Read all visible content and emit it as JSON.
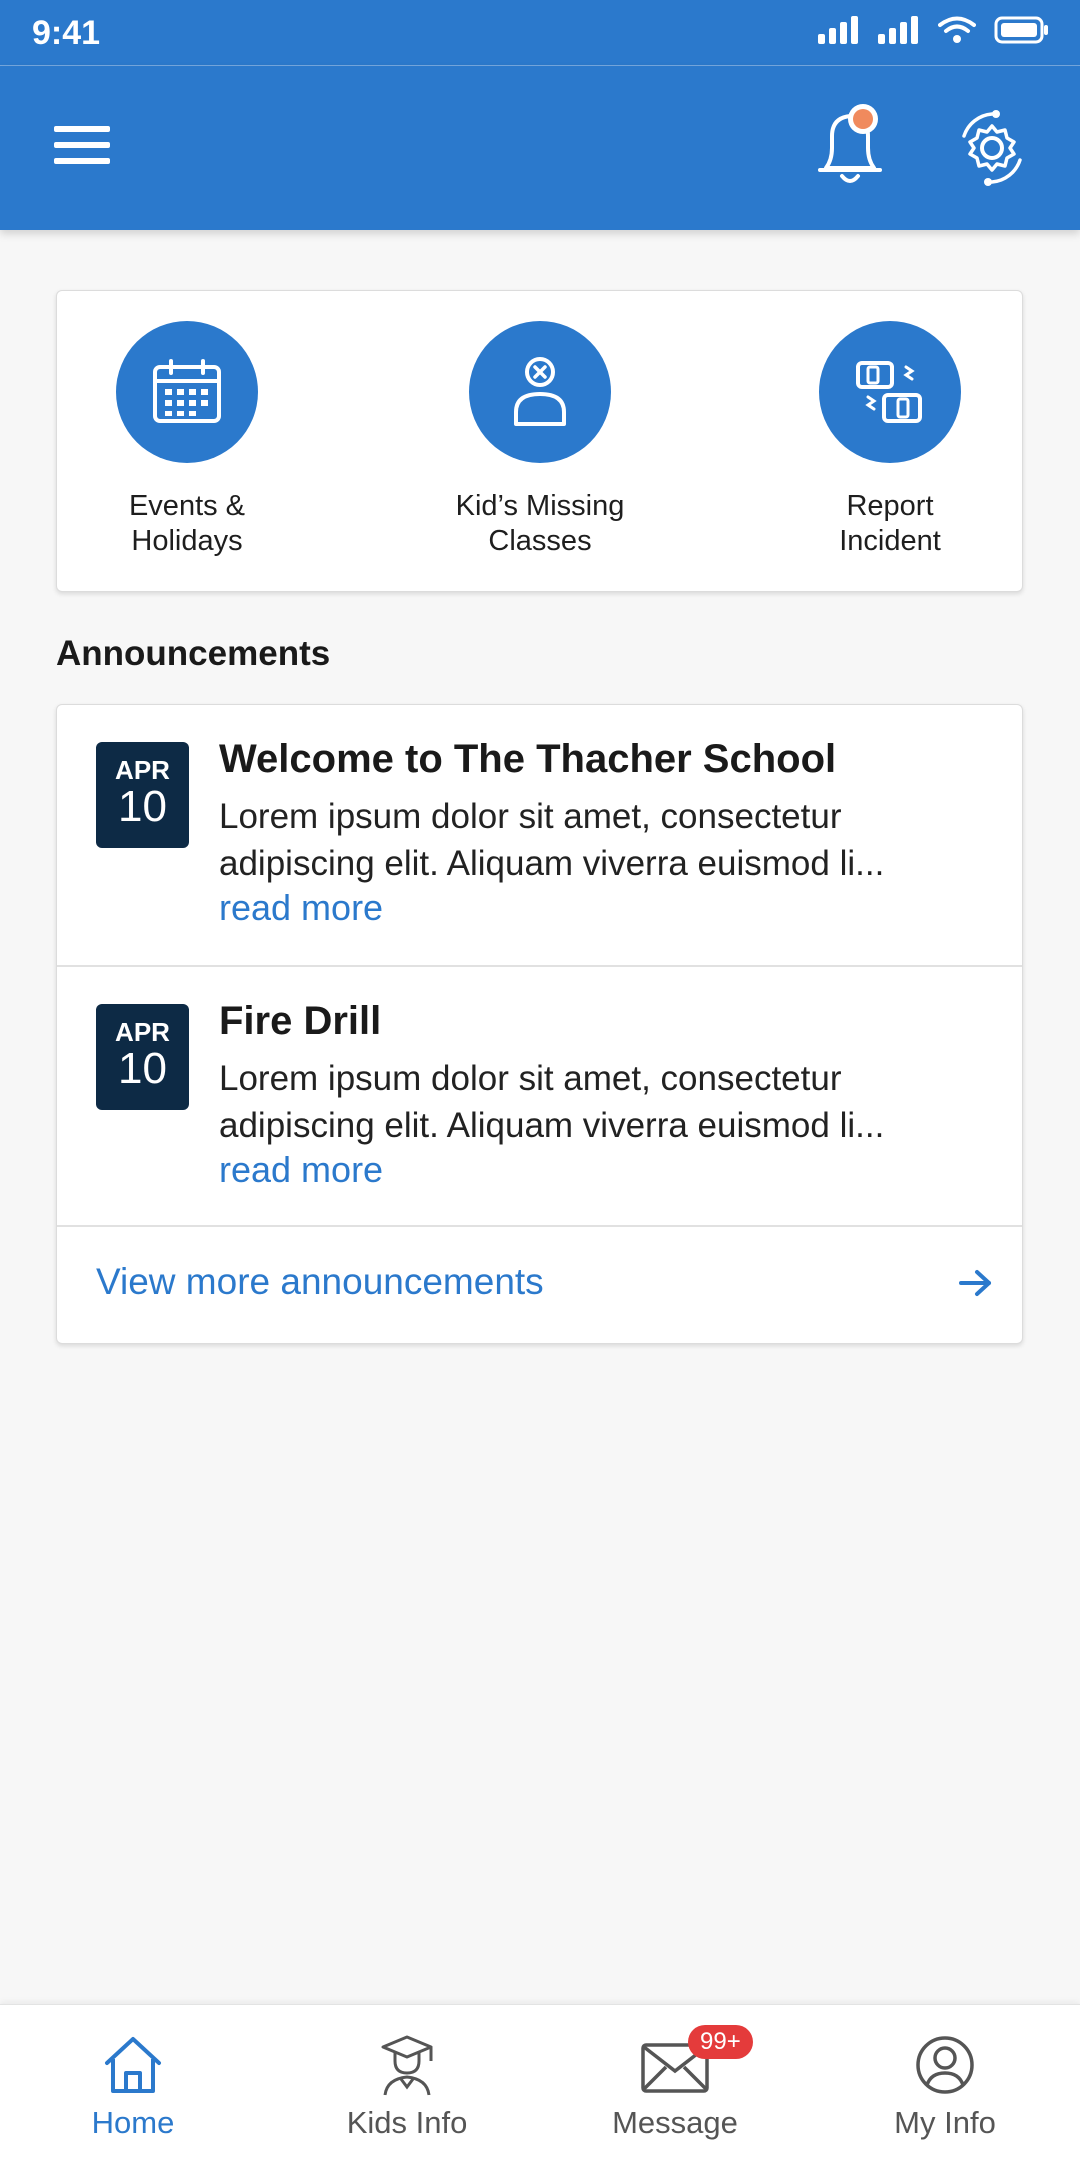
{
  "status_bar": {
    "time": "9:41"
  },
  "colors": {
    "primary": "#2b79cc",
    "date_box": "#0d2a45",
    "badge": "#e43b3b",
    "notification_dot": "#f08a5d"
  },
  "header": {
    "icons": [
      "menu-icon",
      "bell-icon",
      "settings-icon"
    ]
  },
  "quick_actions": [
    {
      "label": "Events &\nHolidays",
      "icon": "calendar-icon"
    },
    {
      "label": "Kid’s Missing\nClasses",
      "icon": "person-missing-icon"
    },
    {
      "label": "Report\nIncident",
      "icon": "incident-icon"
    }
  ],
  "announcements": {
    "title": "Announcements",
    "items": [
      {
        "month": "APR",
        "day": "10",
        "title": "Welcome to The Thacher School",
        "body": "Lorem ipsum dolor sit amet, consectetur adipiscing elit. Aliquam viverra euismod li...",
        "more": "read more"
      },
      {
        "month": "APR",
        "day": "10",
        "title": "Fire Drill",
        "body": "Lorem ipsum dolor sit amet, consectetur adipiscing elit. Aliquam viverra euismod li...",
        "more": "read more"
      }
    ],
    "view_more": "View more announcements"
  },
  "bottom_nav": {
    "items": [
      {
        "label": "Home",
        "icon": "home-icon",
        "active": true
      },
      {
        "label": "Kids Info",
        "icon": "graduate-icon",
        "active": false
      },
      {
        "label": "Message",
        "icon": "mail-icon",
        "active": false,
        "badge": "99+"
      },
      {
        "label": "My Info",
        "icon": "profile-icon",
        "active": false
      }
    ]
  }
}
